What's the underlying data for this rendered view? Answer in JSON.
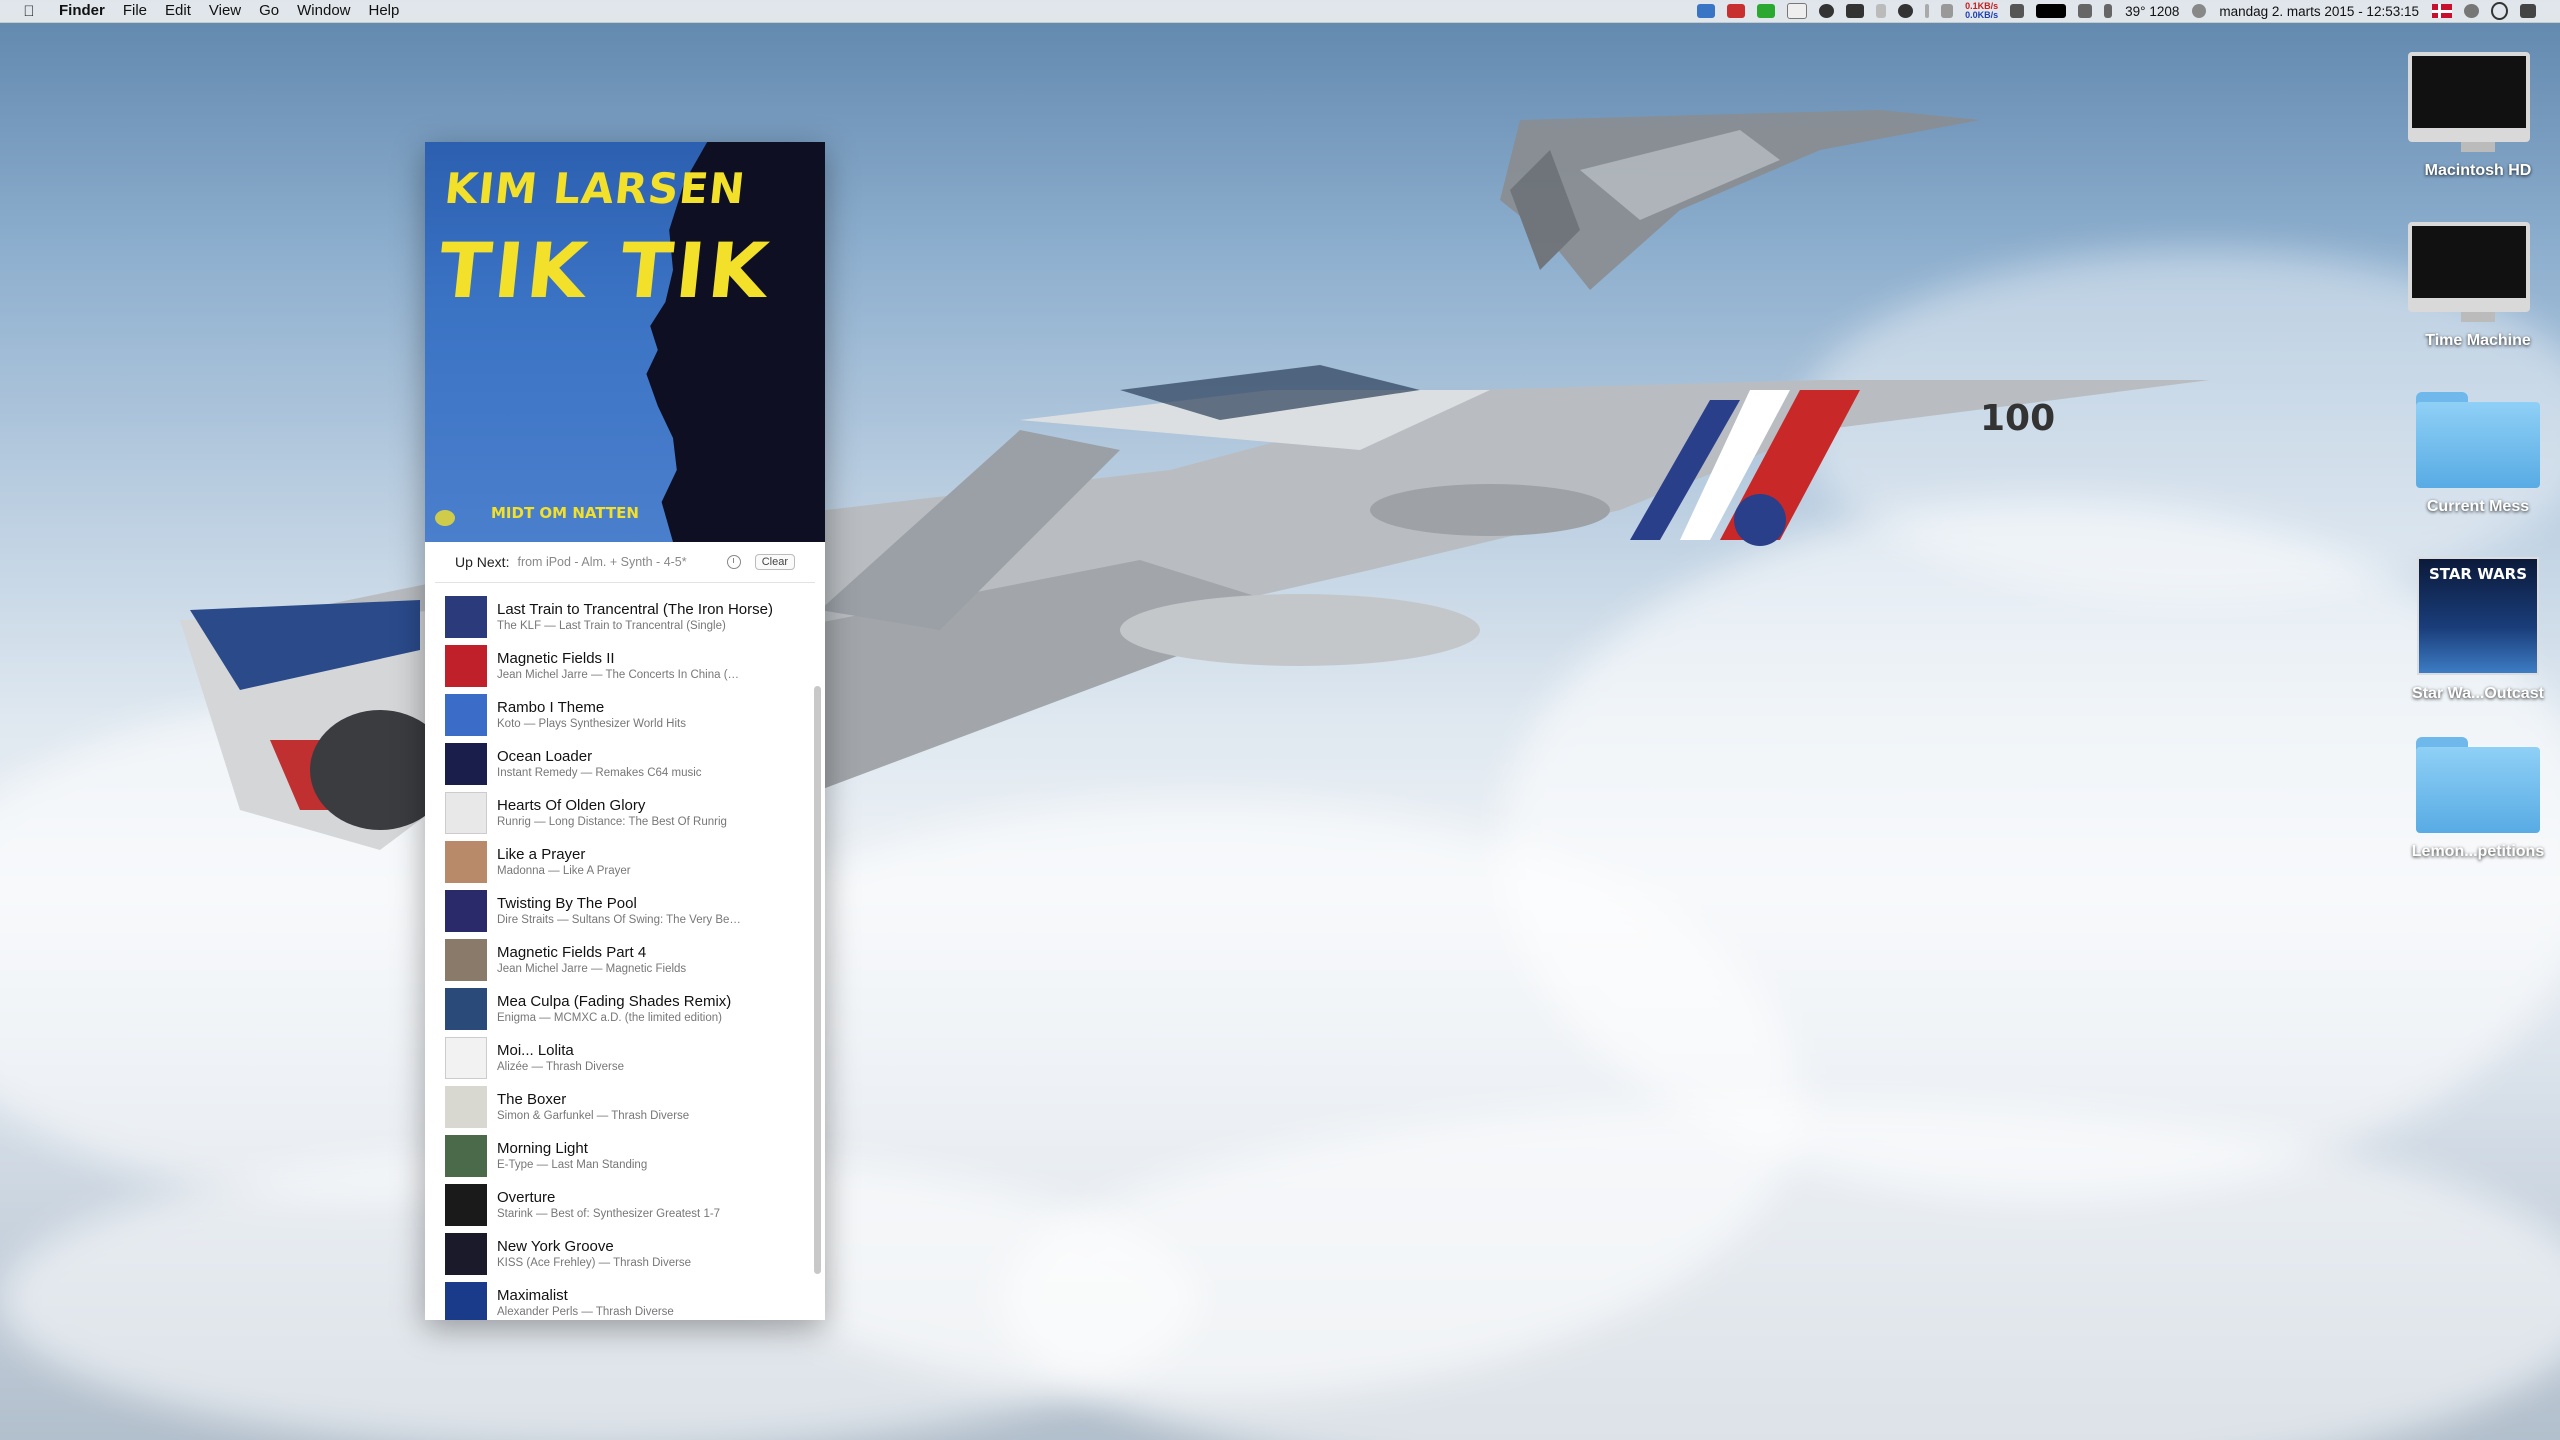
{
  "menubar": {
    "apple_icon": "apple-icon",
    "app_name": "Finder",
    "menus": [
      "File",
      "Edit",
      "View",
      "Go",
      "Window",
      "Help"
    ],
    "status": {
      "net_up": "0.1KB/s",
      "net_down": "0.0KB/s",
      "temperature": "39°",
      "fan": "1208",
      "datetime": "mandag  2. marts 2015 - 12:53:15"
    }
  },
  "player": {
    "album_art": {
      "artist": "KIM LARSEN",
      "title": "TIK TIK",
      "caption": "MIDT OM NATTEN"
    },
    "up_next_label": "Up Next:",
    "source": "from iPod - Alm. + Synth - 4-5*",
    "clear_label": "Clear",
    "tracks": [
      {
        "title": "Last Train to Trancentral (The Iron Horse)",
        "subtitle": "The KLF — Last Train to Trancentral (Single)",
        "color": "#2a3a7a"
      },
      {
        "title": "Magnetic Fields II",
        "subtitle": "Jean Michel Jarre — The Concerts In China (…",
        "color": "#c0202a"
      },
      {
        "title": "Rambo I Theme",
        "subtitle": "Koto — Plays Synthesizer World Hits",
        "color": "#3a6cc8"
      },
      {
        "title": "Ocean Loader",
        "subtitle": "Instant Remedy — Remakes C64 music",
        "color": "#1a1e4a"
      },
      {
        "title": "Hearts Of Olden Glory",
        "subtitle": "Runrig — Long Distance: The Best Of Runrig",
        "color": "#e8e8e8"
      },
      {
        "title": "Like a Prayer",
        "subtitle": "Madonna — Like A Prayer",
        "color": "#b88a6a"
      },
      {
        "title": "Twisting By The Pool",
        "subtitle": "Dire Straits — Sultans Of Swing: The Very Be…",
        "color": "#2a2a6a"
      },
      {
        "title": "Magnetic Fields Part 4",
        "subtitle": "Jean Michel Jarre — Magnetic Fields",
        "color": "#8a7a6a"
      },
      {
        "title": "Mea Culpa (Fading Shades Remix)",
        "subtitle": "Enigma — MCMXC a.D. (the limited edition)",
        "color": "#2a4a7a"
      },
      {
        "title": "Moi... Lolita",
        "subtitle": "Alizée — Thrash Diverse",
        "color": "#f2f2f2"
      },
      {
        "title": "The Boxer",
        "subtitle": "Simon & Garfunkel — Thrash Diverse",
        "color": "#d8d8d0"
      },
      {
        "title": "Morning Light",
        "subtitle": "E-Type — Last Man Standing",
        "color": "#4a6a4a"
      },
      {
        "title": "Overture",
        "subtitle": "Starink — Best of: Synthesizer Greatest 1-7",
        "color": "#1a1a1a"
      },
      {
        "title": "New York Groove",
        "subtitle": "KISS (Ace Frehley) — Thrash Diverse",
        "color": "#1a1a2a"
      },
      {
        "title": "Maximalist",
        "subtitle": "Alexander Perls — Thrash Diverse",
        "color": "#1a3a8a"
      }
    ]
  },
  "desktop": {
    "icons": [
      {
        "label": "Macintosh HD",
        "kind": "imac-icon"
      },
      {
        "label": "Time Machine",
        "kind": "imac-icon"
      },
      {
        "label": "Current Mess",
        "kind": "folder-icon"
      },
      {
        "label": "Star Wa...Outcast",
        "kind": "game-icon",
        "art_text": "STAR WARS"
      },
      {
        "label": "Lemon...petitions",
        "kind": "folder-icon"
      }
    ]
  }
}
